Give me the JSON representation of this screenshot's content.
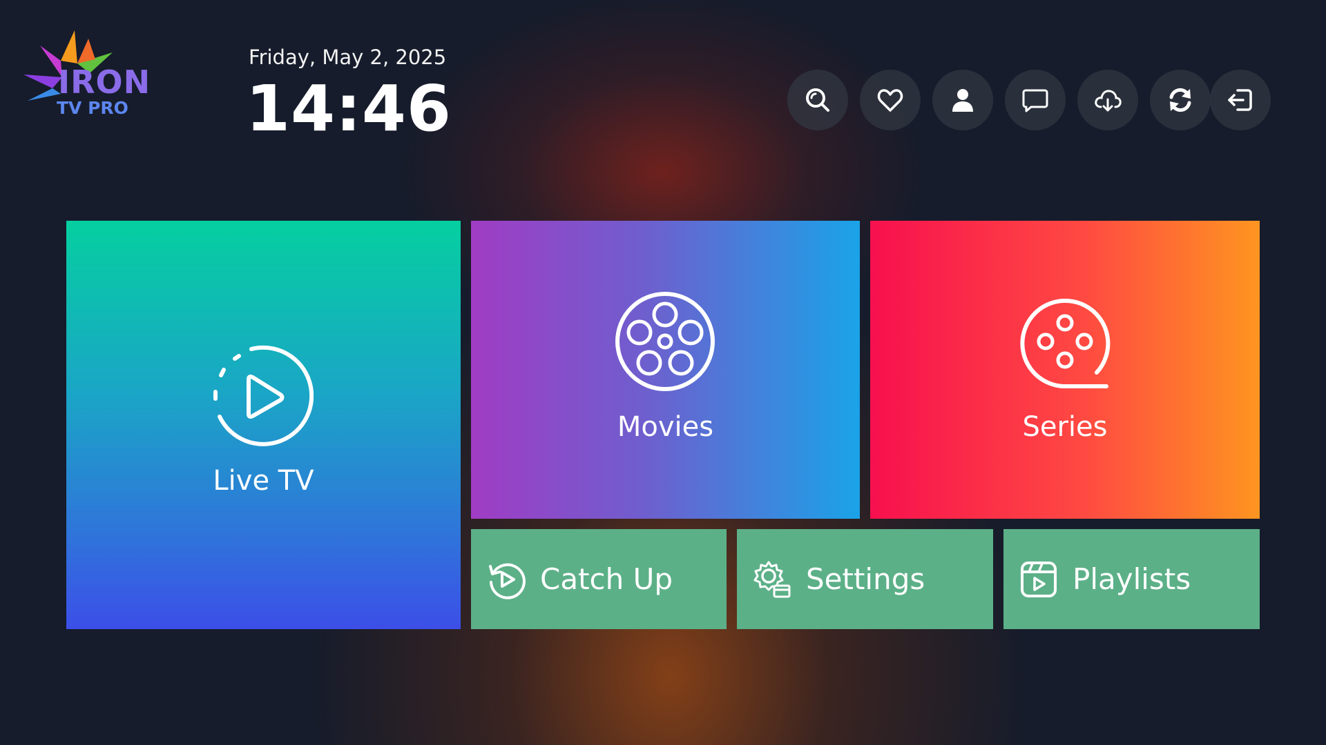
{
  "brand": {
    "logo_text": "IRON",
    "logo_sub": "TV PRO"
  },
  "header": {
    "date": "Friday, May 2, 2025",
    "time": "14:46"
  },
  "toolbar": [
    {
      "icon": "search-icon"
    },
    {
      "icon": "heart-icon"
    },
    {
      "icon": "user-icon"
    },
    {
      "icon": "message-icon"
    },
    {
      "icon": "cloud-download-icon"
    },
    {
      "icon": "refresh-icon"
    },
    {
      "icon": "logout-icon"
    }
  ],
  "tiles": {
    "live_tv": "Live TV",
    "movies": "Movies",
    "series": "Series",
    "catch_up": "Catch Up",
    "settings": "Settings",
    "playlists": "Playlists"
  },
  "colors": {
    "background": "#161c2b",
    "live_tv_gradient": [
      "#05cfa0",
      "#3c4fe8"
    ],
    "movies_gradient": [
      "#a03cc4",
      "#1aa3e8"
    ],
    "series_gradient": [
      "#f7104e",
      "#fe9520"
    ],
    "small_tile": "#5cb088"
  }
}
